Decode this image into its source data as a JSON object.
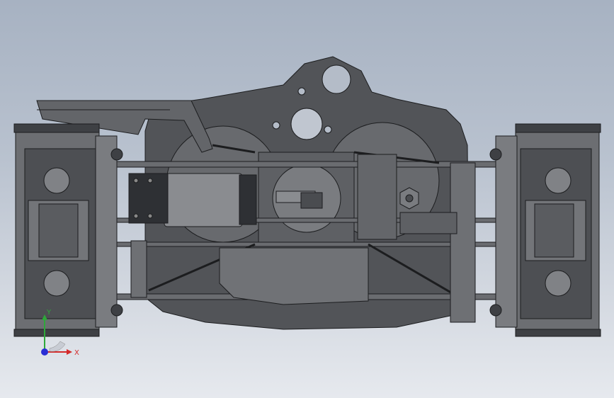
{
  "viewport": {
    "background_top": "#a7b2c2",
    "background_bottom": "#e6e9ee"
  },
  "model": {
    "fill": "#5a5c60",
    "fill_dark": "#3e4044",
    "fill_light": "#7d7f84",
    "fill_motor": "#8a8c90",
    "edge": "#1c1d1f"
  },
  "triad": {
    "x_label": "X",
    "y_label": "Y",
    "x_color": "#d42a2a",
    "y_color": "#2ea83a",
    "z_color": "#2a2ed4"
  }
}
